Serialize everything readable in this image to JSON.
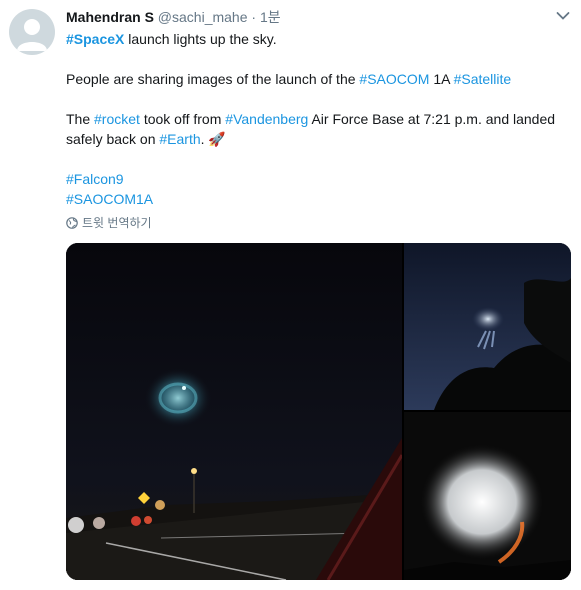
{
  "tweet": {
    "author_name": "Mahendran S",
    "handle": "@sachi_mahe",
    "separator": "·",
    "time": "1분",
    "line1": {
      "hashtag": "#SpaceX",
      "text": " launch lights up the sky."
    },
    "line2": {
      "text": "People are sharing images of the launch of the ",
      "hashtag1": "#SAOCOM",
      "mid": " 1A ",
      "hashtag2": "#Satellite"
    },
    "line3": {
      "t1": "The ",
      "hashtag1": "#rocket",
      "t2": " took off from ",
      "hashtag2": "#Vandenberg",
      "t3": " Air Force Base at 7:21 p.m. and landed safely back on ",
      "hashtag3": "#Earth",
      "t4": ". ",
      "emoji": "🚀"
    },
    "line4": {
      "hashtag": "#Falcon9"
    },
    "line5": {
      "hashtag": "#SAOCOM1A"
    },
    "translate_label": "트윗 번역하기"
  },
  "colors": {
    "link": "#1b95e0",
    "muted": "#657786",
    "text": "#14171a"
  },
  "icons": {
    "caret": "chevron-down-icon",
    "globe": "globe-icon",
    "avatar": "default-avatar-icon"
  }
}
